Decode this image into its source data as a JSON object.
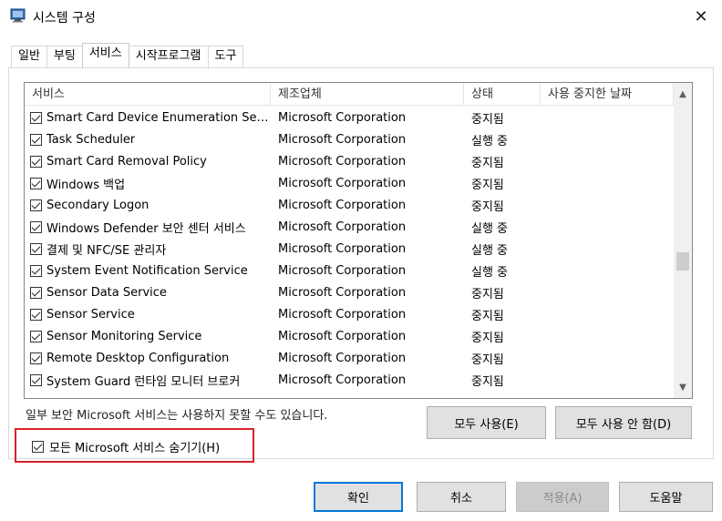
{
  "window": {
    "title": "시스템 구성",
    "close_icon": "close-icon",
    "app_icon": "system-config-icon"
  },
  "tabs": [
    {
      "label": "일반",
      "active": false
    },
    {
      "label": "부팅",
      "active": false
    },
    {
      "label": "서비스",
      "active": true
    },
    {
      "label": "시작프로그램",
      "active": false
    },
    {
      "label": "도구",
      "active": false
    }
  ],
  "services_table": {
    "columns": [
      "서비스",
      "제조업체",
      "상태",
      "사용 중지한 날짜"
    ],
    "rows": [
      {
        "checked": true,
        "name": "Smart Card Device Enumeration Ser...",
        "manufacturer": "Microsoft Corporation",
        "status": "중지됨",
        "date": ""
      },
      {
        "checked": true,
        "name": "Task Scheduler",
        "manufacturer": "Microsoft Corporation",
        "status": "실행 중",
        "date": ""
      },
      {
        "checked": true,
        "name": "Smart Card Removal Policy",
        "manufacturer": "Microsoft Corporation",
        "status": "중지됨",
        "date": ""
      },
      {
        "checked": true,
        "name": "Windows 백업",
        "manufacturer": "Microsoft Corporation",
        "status": "중지됨",
        "date": ""
      },
      {
        "checked": true,
        "name": "Secondary Logon",
        "manufacturer": "Microsoft Corporation",
        "status": "중지됨",
        "date": ""
      },
      {
        "checked": true,
        "name": "Windows Defender 보안 센터 서비스",
        "manufacturer": "Microsoft Corporation",
        "status": "실행 중",
        "date": ""
      },
      {
        "checked": true,
        "name": "결제 및 NFC/SE 관리자",
        "manufacturer": "Microsoft Corporation",
        "status": "실행 중",
        "date": ""
      },
      {
        "checked": true,
        "name": "System Event Notification Service",
        "manufacturer": "Microsoft Corporation",
        "status": "실행 중",
        "date": ""
      },
      {
        "checked": true,
        "name": "Sensor Data Service",
        "manufacturer": "Microsoft Corporation",
        "status": "중지됨",
        "date": ""
      },
      {
        "checked": true,
        "name": "Sensor Service",
        "manufacturer": "Microsoft Corporation",
        "status": "중지됨",
        "date": ""
      },
      {
        "checked": true,
        "name": "Sensor Monitoring Service",
        "manufacturer": "Microsoft Corporation",
        "status": "중지됨",
        "date": ""
      },
      {
        "checked": true,
        "name": "Remote Desktop Configuration",
        "manufacturer": "Microsoft Corporation",
        "status": "중지됨",
        "date": ""
      },
      {
        "checked": true,
        "name": "System Guard 런타임 모니터 브로커",
        "manufacturer": "Microsoft Corporation",
        "status": "중지됨",
        "date": ""
      }
    ]
  },
  "note_text": "일부 보안 Microsoft 서비스는 사용하지 못할 수도 있습니다.",
  "enable_all_label": "모두 사용(E)",
  "disable_all_label": "모두 사용 안 함(D)",
  "hide_ms_checkbox": {
    "checked": true,
    "label": "모든 Microsoft 서비스 숨기기(H)"
  },
  "highlight_color": "#d9232a",
  "footer": {
    "ok_label": "확인",
    "cancel_label": "취소",
    "apply_label": "적용(A)",
    "help_label": "도움말"
  }
}
